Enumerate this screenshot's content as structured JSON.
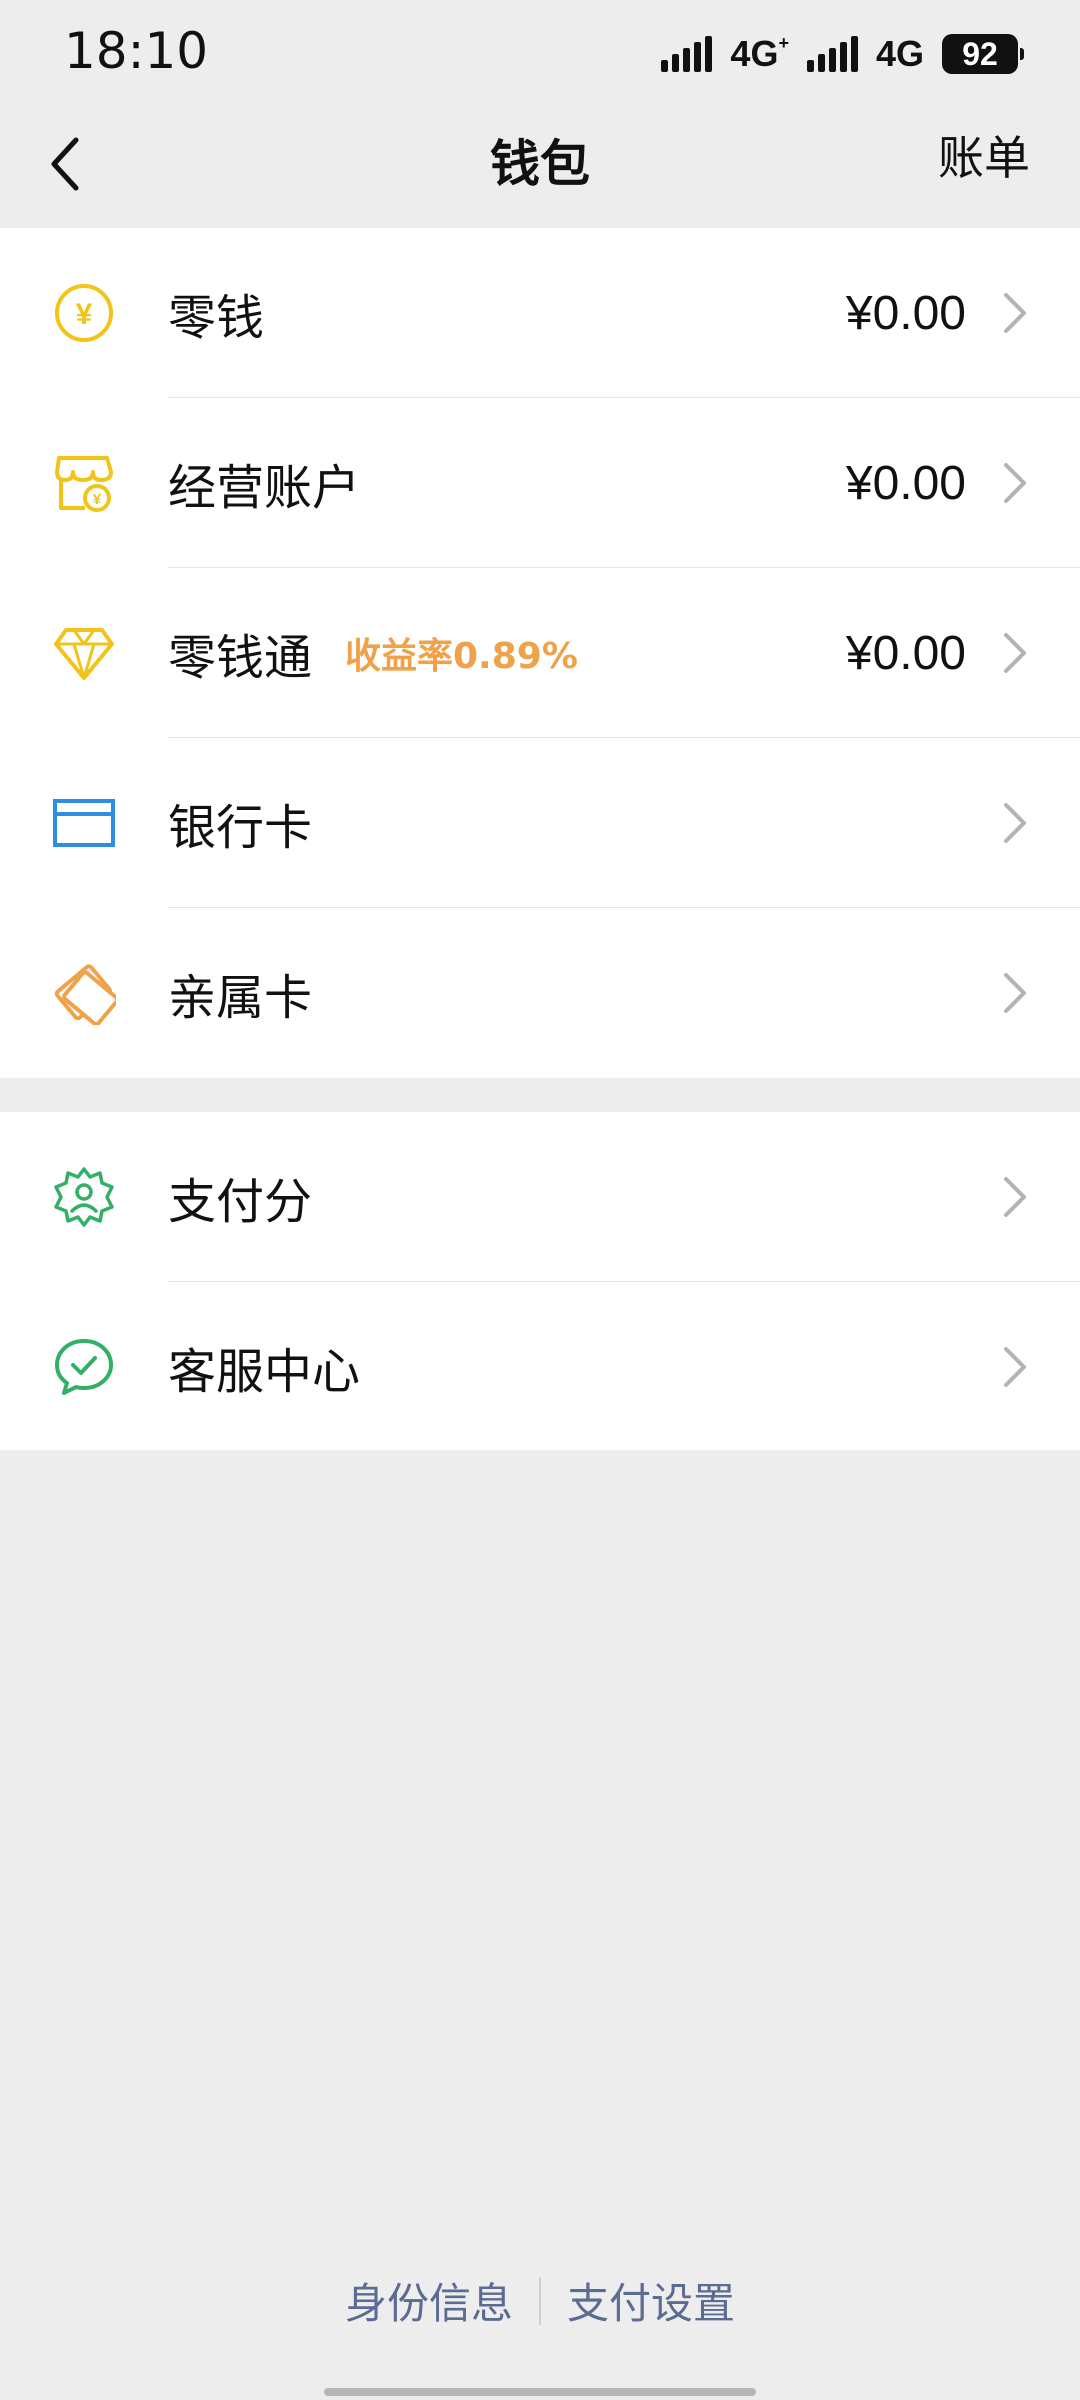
{
  "status_bar": {
    "time": "18:10",
    "network_1": "4G",
    "network_1_plus": "+",
    "network_2": "4G",
    "battery": "92"
  },
  "nav": {
    "title": "钱包",
    "right_label": "账单"
  },
  "section_1": [
    {
      "label": "零钱",
      "value": "¥0.00",
      "icon": "yen-coin-icon",
      "color": "#f2c318"
    },
    {
      "label": "经营账户",
      "value": "¥0.00",
      "icon": "shop-account-icon",
      "color": "#f2c318"
    },
    {
      "label": "零钱通",
      "badge": "收益率0.89%",
      "value": "¥0.00",
      "icon": "diamond-icon",
      "color": "#f2c318"
    },
    {
      "label": "银行卡",
      "value": "",
      "icon": "bank-card-icon",
      "color": "#2e8fe0"
    },
    {
      "label": "亲属卡",
      "value": "",
      "icon": "family-card-icon",
      "color": "#f0a24a"
    }
  ],
  "section_2": [
    {
      "label": "支付分",
      "icon": "pay-score-icon",
      "color": "#31b066"
    },
    {
      "label": "客服中心",
      "icon": "customer-service-icon",
      "color": "#31b066"
    }
  ],
  "footer": {
    "link_1": "身份信息",
    "link_2": "支付设置",
    "link_color": "#5b6c93"
  },
  "colors": {
    "background": "#ededed",
    "card": "#ffffff",
    "badge": "#f0a24a"
  }
}
